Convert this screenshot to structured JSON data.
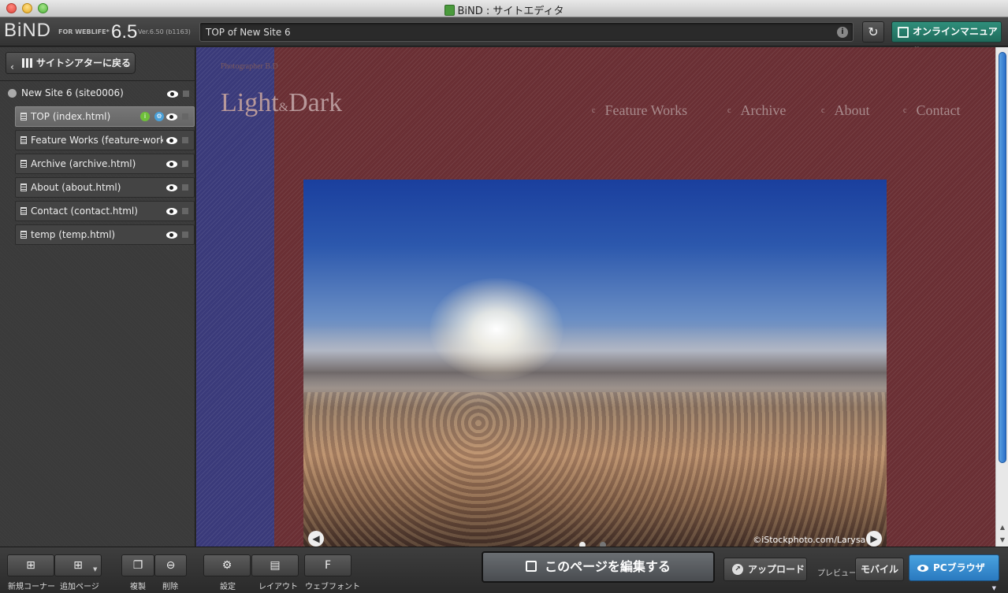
{
  "window": {
    "title": "BiND : サイトエディタ"
  },
  "toolbar": {
    "logo": "BiND",
    "logo_sub": "FOR WEBLIFE*",
    "version_big": "6.5",
    "version_small": "Ver.6.50 (b1163)",
    "address": "TOP of New Site 6",
    "manual_label": "オンラインマニュアル"
  },
  "sidebar": {
    "back_label": "サイトシアターに戻る",
    "site_label": "New Site 6 (site0006)",
    "pages": [
      {
        "label": "TOP (index.html)"
      },
      {
        "label": "Feature Works (feature-works.html)"
      },
      {
        "label": "Archive (archive.html)"
      },
      {
        "label": "About (about.html)"
      },
      {
        "label": "Contact (contact.html)"
      },
      {
        "label": "temp (temp.html)"
      }
    ]
  },
  "preview": {
    "photographer": "Photographer B.D",
    "brand_light": "Light",
    "brand_amp": "&",
    "brand_dark": "Dark",
    "nav": [
      "Feature Works",
      "Archive",
      "About",
      "Contact"
    ],
    "credit": "©iStockphoto.com/Larysa Do"
  },
  "bottom": {
    "new_corner": "新規コーナー",
    "add_page": "追加ページ",
    "duplicate": "複製",
    "delete": "削除",
    "settings": "設定",
    "layout": "レイアウト",
    "webfont": "ウェブフォント",
    "edit_page": "このページを編集する",
    "upload": "アップロード",
    "preview_label": "プレビュー",
    "mobile": "モバイル",
    "pc_browser": "PCブラウザ"
  },
  "colors": {
    "accent_teal": "#2f8f7b",
    "accent_blue": "#2a79bf",
    "stripe_blue": "#3a3a7a",
    "stripe_red": "#6a2f34"
  }
}
